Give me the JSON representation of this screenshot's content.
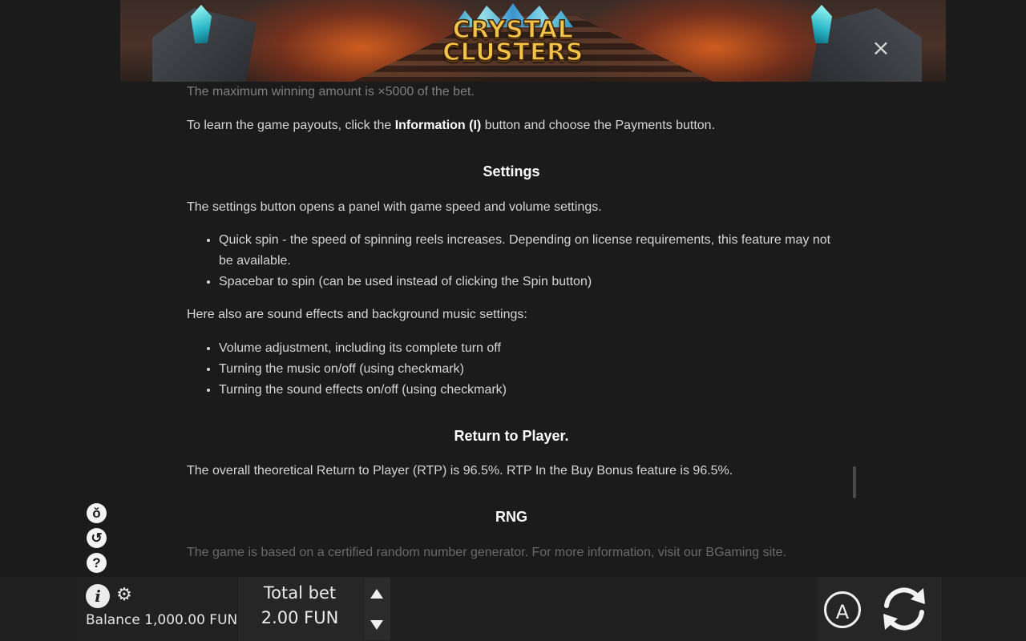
{
  "header": {
    "logo_line1": "CRYSTAL",
    "logo_line2": "CLUSTERS",
    "close_label": "×"
  },
  "content": {
    "max_win": "The maximum winning amount is ×5000 of the bet.",
    "payouts_pre": "To learn the game payouts, click the ",
    "payouts_bold": "Information (I)",
    "payouts_post": " button and choose the Payments button.",
    "settings_heading": "Settings",
    "settings_intro": "The settings button opens a panel with game speed and volume settings.",
    "settings_items": [
      "Quick spin - the speed of spinning reels increases. Depending on license requirements, this feature may not be available.",
      "Spacebar to spin (can be used instead of clicking the Spin button)"
    ],
    "sound_intro": "Here also are sound effects and background music settings:",
    "sound_items": [
      "Volume adjustment, including its complete turn off",
      "Turning the music on/off (using checkmark)",
      "Turning the sound effects on/off (using checkmark)"
    ],
    "rtp_heading": "Return to Player.",
    "rtp_text": "The overall theoretical Return to Player (RTP) is 96.5%. RTP In the Buy Bonus feature is 96.5%.",
    "rng_heading": "RNG",
    "rng_text": "The game is based on a certified random number generator. For more information, visit our BGaming site."
  },
  "side_icons": {
    "fast": "ǒ",
    "history": "↺",
    "help": "?"
  },
  "bottom": {
    "info_label": "i",
    "gear_label": "⚙",
    "balance": "Balance 1,000.00 FUN",
    "total_bet_label": "Total bet",
    "total_bet_value": "2.00 FUN",
    "auto_label": "A"
  },
  "colors": {
    "background": "#1b1b1b",
    "text": "#d6d6d6",
    "heading": "#ffffff",
    "logo_gold": "#f3c349"
  }
}
